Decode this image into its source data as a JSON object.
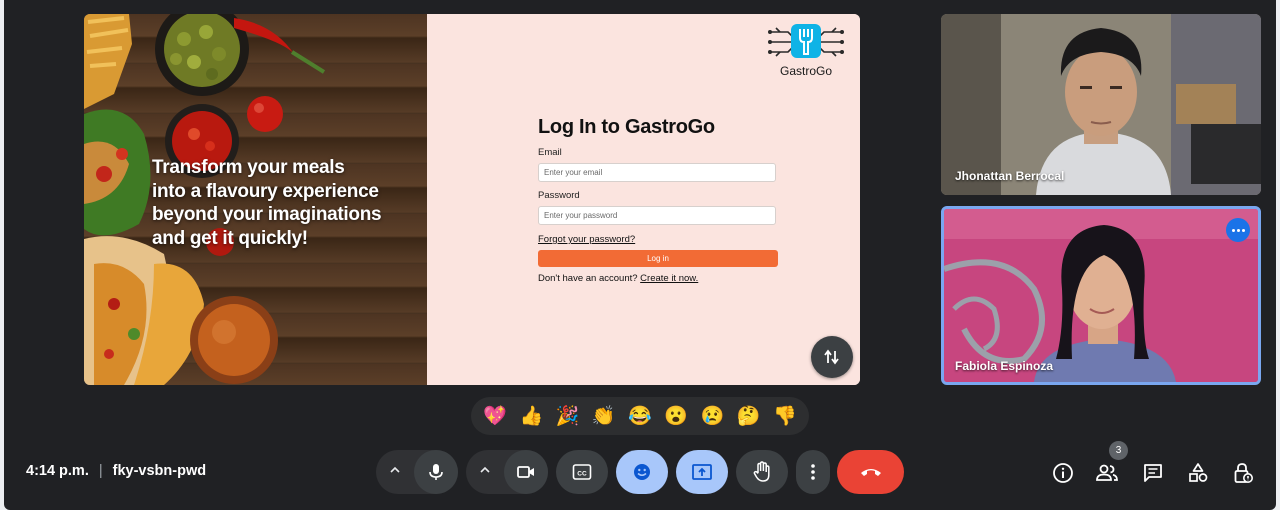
{
  "presentation": {
    "hero_text": "Transform your meals into a flavoury experience beyond your imaginations and get it quickly!",
    "logo_name": "GastroGo",
    "login": {
      "title": "Log In to GastroGo",
      "email_label": "Email",
      "email_placeholder": "Enter your email",
      "password_label": "Password",
      "password_placeholder": "Enter your password",
      "forgot_link": "Forgot your password?",
      "login_button": "Log in",
      "signup_prompt": "Don't have an account?",
      "signup_link": "Create it now."
    },
    "swap_icon": "swap-vertical-icon"
  },
  "participants": [
    {
      "name": "Jhonattan Berrocal"
    },
    {
      "name": "Fabiola Espinoza"
    }
  ],
  "reactions": [
    "💖",
    "👍",
    "🎉",
    "👏",
    "😂",
    "😮",
    "😢",
    "🤔",
    "👎"
  ],
  "meeting": {
    "time": "4:14 p.m.",
    "separator": "|",
    "code": "fky-vsbn-pwd"
  },
  "controls": [
    {
      "name": "mic-button",
      "icon": "mic-icon"
    },
    {
      "name": "camera-button",
      "icon": "camera-icon"
    },
    {
      "name": "captions-button",
      "icon": "closed-captions-icon"
    },
    {
      "name": "emoji-button",
      "icon": "emoji-icon",
      "active": true
    },
    {
      "name": "present-button",
      "icon": "present-screen-icon",
      "active": true
    },
    {
      "name": "raise-hand-button",
      "icon": "hand-icon"
    },
    {
      "name": "more-options-button",
      "icon": "more-vert-icon"
    },
    {
      "name": "end-call-button",
      "icon": "call-end-icon"
    }
  ],
  "side_panel": {
    "people_count": "3",
    "icons": [
      "info-icon",
      "people-icon",
      "chat-icon",
      "activities-icon",
      "host-controls-icon"
    ]
  },
  "colors": {
    "background": "#202124",
    "control": "#3c4043",
    "active_control": "#a8c7fa",
    "end_call": "#ea4335",
    "login_accent": "#f26b35",
    "login_bg": "#fbe4df",
    "speaker_border": "#7aa7f0"
  }
}
